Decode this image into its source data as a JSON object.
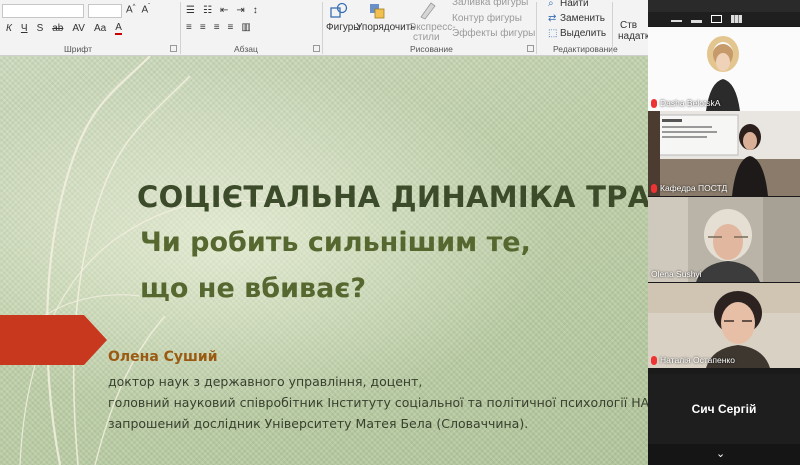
{
  "ribbon": {
    "groups": {
      "font": "Шрифт",
      "paragraph": "Абзац",
      "drawing": "Рисование",
      "editing": "Редактирование"
    },
    "buttons": {
      "shapes": "Фигуры",
      "arrange": "Упорядочить",
      "express_styles": "Экспресс-",
      "express_styles_2": "стили",
      "shape_fill": "Заливка фигуры",
      "shape_outline": "Контур фигуры",
      "shape_effects": "Эффекты фигуры",
      "find": "Найти",
      "replace": "Заменить",
      "select": "Выделить",
      "cut_1": "Ств",
      "cut_2": "надатк"
    },
    "font_format": {
      "italic": "К",
      "underline": "Ч",
      "strike": "S",
      "shadow": "ab"
    }
  },
  "slide": {
    "title": "СОЦІЄТАЛЬНА ДИНАМІКА ТРАНСФОРМАЦІЙ",
    "subtitle_line1": "Чи робить сильнішим те,",
    "subtitle_line2": "що не вбиває?",
    "author": "Олена Суший",
    "bio_line1": "доктор наук з державного управління, доцент,",
    "bio_line2": "головний науковий співробітник Інституту соціальної та політичної психології НАПН України,",
    "bio_line3": "запрошений дослідник Університету Матея Бела (Словаччина)."
  },
  "participants": [
    {
      "name": "Dasha BelotskA",
      "muted": true
    },
    {
      "name": "Кафедра ПОСТД",
      "muted": true
    },
    {
      "name": "Olena Sushyi",
      "muted": false
    },
    {
      "name": "Наталія Остапенко",
      "muted": true
    }
  ],
  "current_speaker_card": "Сич Сергій",
  "colors": {
    "accent_red": "#c8381f",
    "title_color": "#3c4b2a",
    "author_color": "#9a5a12"
  }
}
